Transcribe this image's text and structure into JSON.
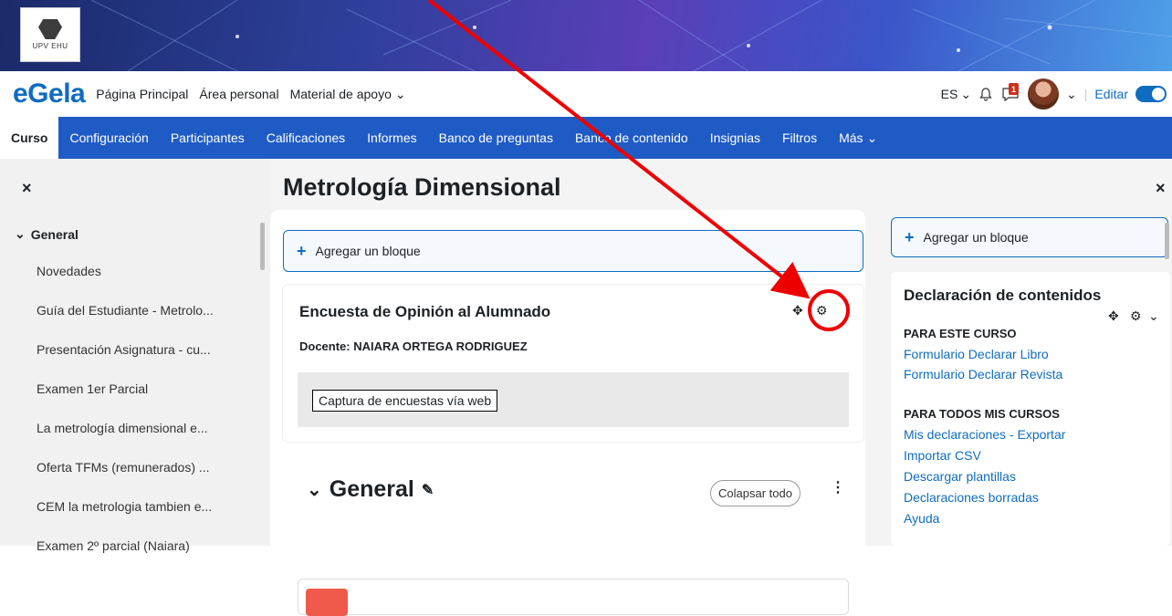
{
  "banner": {
    "logo_text": "UPV EHU"
  },
  "topnav": {
    "brand": "eGela",
    "links": [
      "Página Principal",
      "Área personal",
      "Material de apoyo"
    ],
    "lang": "ES",
    "notifications_badge": "1",
    "edit_label": "Editar"
  },
  "secnav": {
    "items": [
      "Curso",
      "Configuración",
      "Participantes",
      "Calificaciones",
      "Informes",
      "Banco de preguntas",
      "Banco de contenido",
      "Insignias",
      "Filtros",
      "Más"
    ]
  },
  "leftdrawer": {
    "close": "×",
    "section": "General",
    "items": [
      "Novedades",
      "Guía del Estudiante - Metrolo...",
      "Presentación Asignatura - cu...",
      "Examen 1er Parcial",
      "La metrología dimensional e...",
      "Oferta TFMs (remunerados) ...",
      "CEM la metrologia tambien e...",
      "Examen 2º parcial (Naiara)"
    ]
  },
  "main": {
    "course_title": "Metrología Dimensional",
    "add_block": "Agregar un bloque",
    "survey": {
      "title": "Encuesta de Opinión al Alumnado",
      "teacher": "Docente: NAIARA ORTEGA RODRIGUEZ",
      "button": "Captura de encuestas vía web"
    },
    "section_title": "General",
    "collapse_all": "Colapsar todo"
  },
  "rightdrawer": {
    "close": "×",
    "add_block": "Agregar un bloque",
    "block_title": "Declaración de contenidos",
    "heading1": "PARA ESTE CURSO",
    "links1": [
      "Formulario Declarar Libro",
      "Formulario Declarar Revista"
    ],
    "heading2": "PARA TODOS MIS CURSOS",
    "links2": [
      "Mis declaraciones - Exportar",
      "Importar CSV",
      "Descargar plantillas",
      "Declaraciones borradas",
      "Ayuda"
    ]
  },
  "colors": {
    "brand": "#0f6cbf",
    "secnav": "#1f5bc4",
    "annotation": "#e00000"
  }
}
